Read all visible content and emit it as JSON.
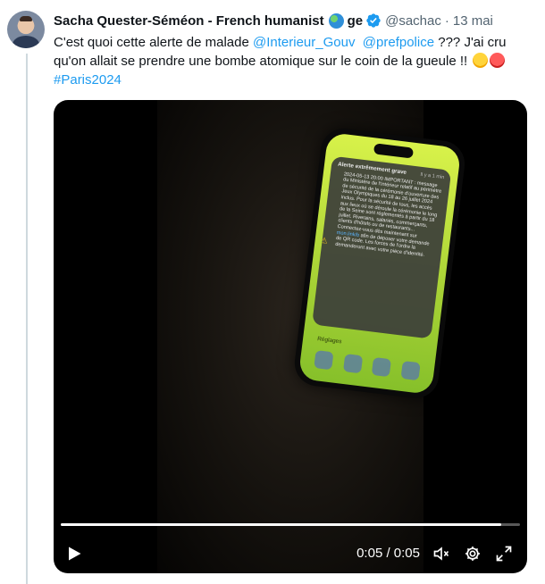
{
  "tweet": {
    "author_name": "Sacha Quester-Séméon - French humanist",
    "author_suffix": "ge",
    "handle": "@sachac",
    "separator": "·",
    "date": "13 mai",
    "text_part1": "C'est quoi cette alerte de malade ",
    "mention1": "@Interieur_Gouv",
    "mention2": "@prefpolice",
    "text_part2": " ??? J'ai cru qu'on allait se prendre une bombe atomique sur le coin de la gueule !! ",
    "hashtag": "#Paris2024"
  },
  "phone_alert": {
    "title": "Alerte extrêmement grave",
    "ago": "Il y a 1 min",
    "body": "2024-05-13 20:00 IMPORTANT : message du Ministère de l'Intérieur relatif au périmètre de sécurité de la cérémonie d'ouverture des Jeux Olympiques du 18 au 26 juillet 2024 inclus. Pour la sécurité de tous, les accès aux lieux où se déroule la cérémonie le long de la Seine sont réglementés à partir du 18 juillet. Riverains, salariés, commerçants, clients d'hôtels ou de restaurants... Connectez-vous dès maintenant sur ",
    "link": "mon.link/b",
    "body2": " afin de déposer votre demande de QR code. Les forces de l'ordre la demanderont avec votre pièce d'identité.",
    "settings_label": "Réglages"
  },
  "video": {
    "time_display": "0:05 / 0:05",
    "progress": 0.96
  },
  "colors": {
    "link": "#1d9bf0",
    "text": "#0f1419",
    "muted": "#536471"
  }
}
